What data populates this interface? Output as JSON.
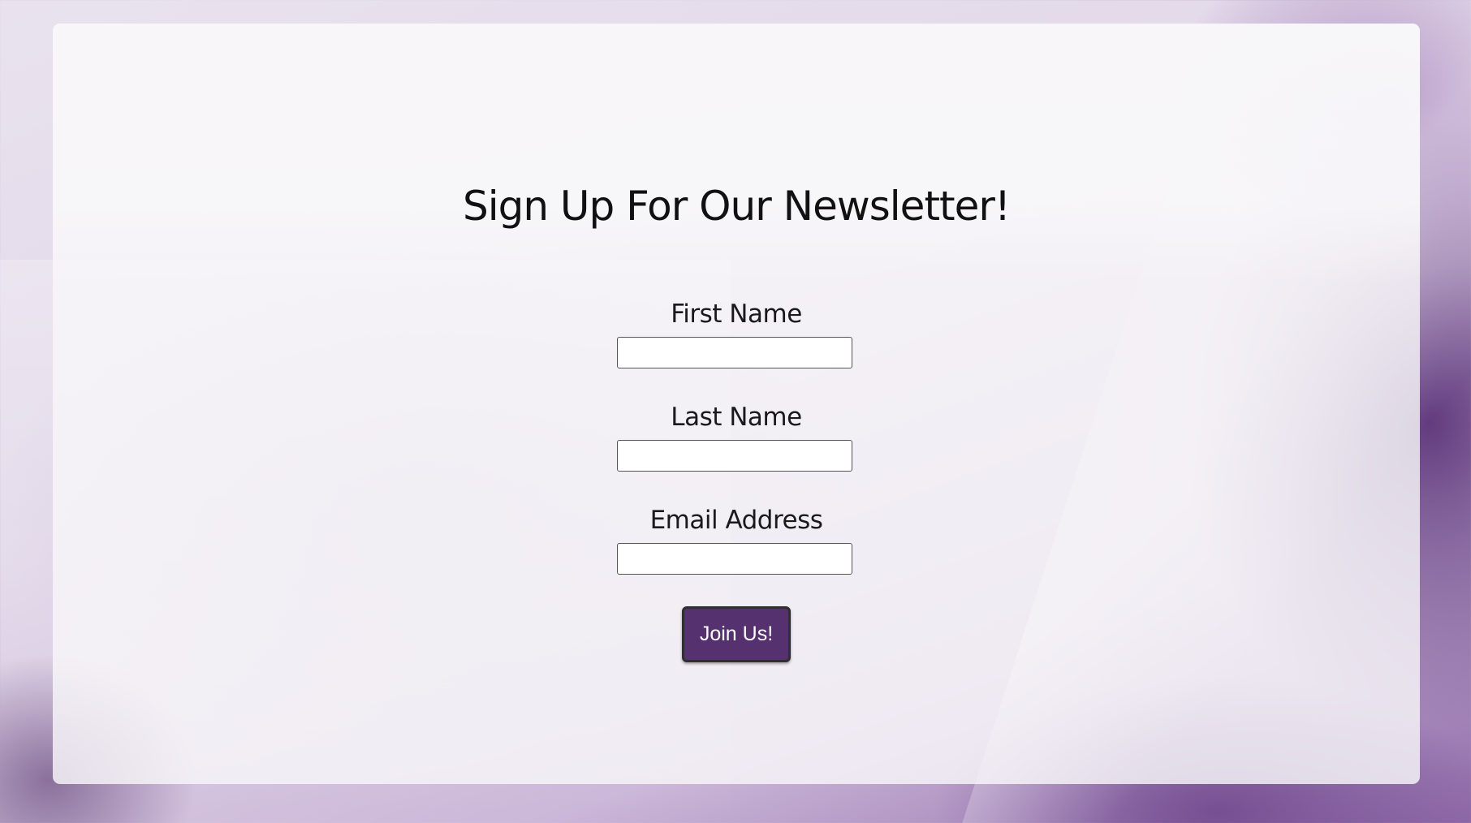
{
  "newsletter": {
    "title": "Sign Up For Our Newsletter!",
    "fields": {
      "first_name": {
        "label": "First Name",
        "value": ""
      },
      "last_name": {
        "label": "Last Name",
        "value": ""
      },
      "email": {
        "label": "Email Address",
        "value": ""
      }
    },
    "submit_label": "Join Us!"
  },
  "colors": {
    "button_background": "#563170",
    "card_background": "#f8f7f9",
    "accent_purple": "#7a4c9a"
  }
}
